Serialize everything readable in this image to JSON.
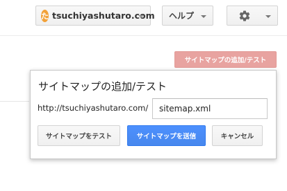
{
  "header": {
    "site": {
      "avatar_char": "た",
      "name": "tsuchiyashutaro.com"
    },
    "help_label": "ヘルプ",
    "settings_icon": "gear-icon"
  },
  "toolbar": {
    "add_test_sitemap_label": "サイトマップの追加/テスト"
  },
  "dialog": {
    "title": "サイトマップの追加/テスト",
    "url_prefix": "http://tsuchiyashutaro.com/",
    "sitemap_value": "sitemap.xml",
    "buttons": {
      "test": "サイトマップをテスト",
      "submit": "サイトマップを送信",
      "cancel": "キャンセル"
    }
  },
  "colors": {
    "primary": "#4d90fe",
    "trigger": "#e8a3a0",
    "avatar": "#f2a23a"
  }
}
